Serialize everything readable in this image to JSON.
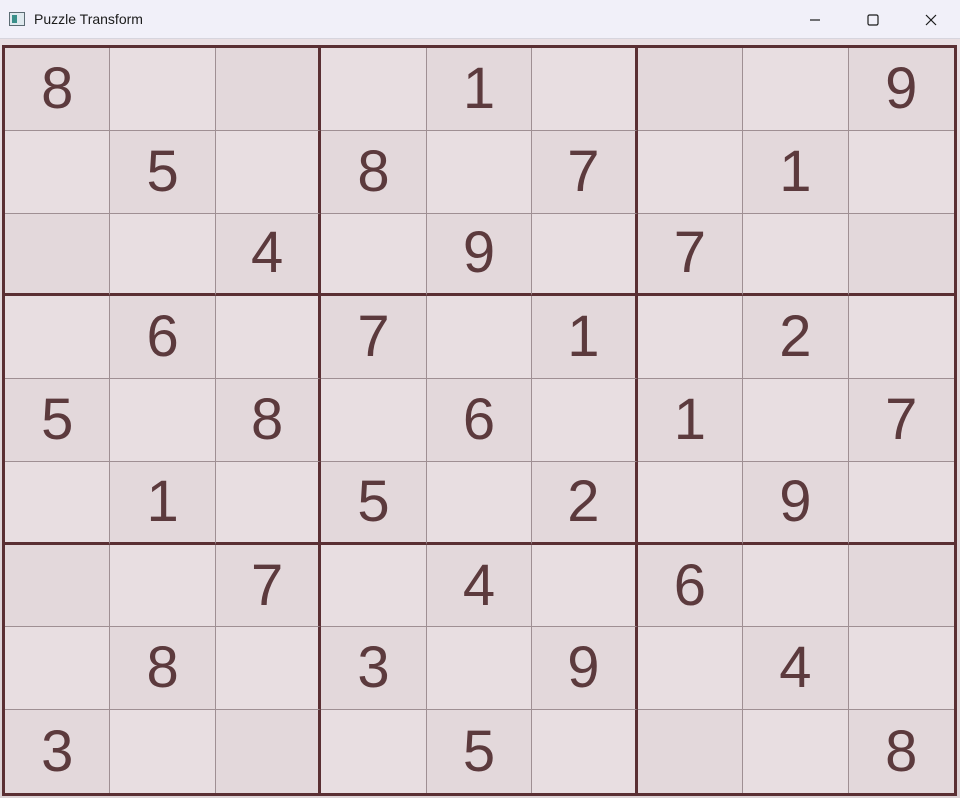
{
  "window": {
    "title": "Puzzle Transform",
    "icon": "app-window-icon",
    "controls": {
      "minimize_icon": "minimize-icon",
      "maximize_icon": "maximize-icon",
      "close_icon": "close-icon"
    }
  },
  "colors": {
    "grid_line": "#5a2f33",
    "digit": "#5c3a3d",
    "paper": "#e6dcdf"
  },
  "puzzle": {
    "rows": [
      [
        "8",
        "",
        "",
        "",
        "1",
        "",
        "",
        "",
        "9"
      ],
      [
        "",
        "5",
        "",
        "8",
        "",
        "7",
        "",
        "1",
        ""
      ],
      [
        "",
        "",
        "4",
        "",
        "9",
        "",
        "7",
        "",
        ""
      ],
      [
        "",
        "6",
        "",
        "7",
        "",
        "1",
        "",
        "2",
        ""
      ],
      [
        "5",
        "",
        "8",
        "",
        "6",
        "",
        "1",
        "",
        "7"
      ],
      [
        "",
        "1",
        "",
        "5",
        "",
        "2",
        "",
        "9",
        ""
      ],
      [
        "",
        "",
        "7",
        "",
        "4",
        "",
        "6",
        "",
        ""
      ],
      [
        "",
        "8",
        "",
        "3",
        "",
        "9",
        "",
        "4",
        ""
      ],
      [
        "3",
        "",
        "",
        "",
        "5",
        "",
        "",
        "",
        "8"
      ]
    ]
  }
}
